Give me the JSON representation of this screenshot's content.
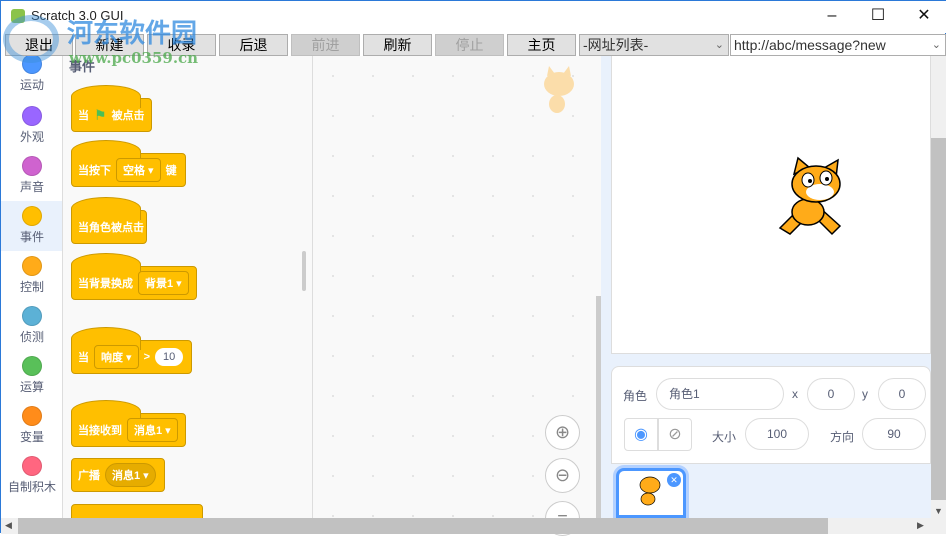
{
  "window": {
    "title": "Scratch 3.0 GUI",
    "controls": [
      "minimize",
      "maximize",
      "close"
    ]
  },
  "toolbar": {
    "buttons": [
      {
        "label": "退出",
        "enabled": true
      },
      {
        "label": "新建",
        "enabled": true
      },
      {
        "label": "收录",
        "enabled": true
      },
      {
        "label": "后退",
        "enabled": true
      },
      {
        "label": "前进",
        "enabled": false
      },
      {
        "label": "刷新",
        "enabled": true
      },
      {
        "label": "停止",
        "enabled": false
      },
      {
        "label": "主页",
        "enabled": true
      }
    ],
    "url_list": "-网址列表-",
    "url": "http://abc/message?new"
  },
  "categories": [
    {
      "label": "运动",
      "color": "#4c97ff"
    },
    {
      "label": "外观",
      "color": "#9966ff"
    },
    {
      "label": "声音",
      "color": "#cf63cf"
    },
    {
      "label": "事件",
      "color": "#ffbf00",
      "selected": true
    },
    {
      "label": "控制",
      "color": "#ffab19"
    },
    {
      "label": "侦测",
      "color": "#5cb1d6"
    },
    {
      "label": "运算",
      "color": "#59c059"
    },
    {
      "label": "变量",
      "color": "#ff8c1a"
    },
    {
      "label": "自制积木",
      "color": "#ff6680"
    }
  ],
  "palette": {
    "heading": "事件",
    "blocks": {
      "flag": {
        "pre": "当",
        "post": "被点击"
      },
      "key": {
        "pre": "当按下",
        "dropdown": "空格",
        "post": "键"
      },
      "sprite": {
        "text": "当角色被点击"
      },
      "backdrop": {
        "pre": "当背景换成",
        "dropdown": "背景1"
      },
      "loud": {
        "pre": "当",
        "dropdown": "响度",
        "op": ">",
        "value": "10"
      },
      "receive": {
        "pre": "当接收到",
        "dropdown": "消息1"
      },
      "broadcast": {
        "pre": "广播",
        "dropdown": "消息1"
      }
    }
  },
  "sprite_info": {
    "sprite_label": "角色",
    "sprite_name": "角色1",
    "x_label": "x",
    "x": "0",
    "y_label": "y",
    "y": "0",
    "size_label": "大小",
    "size": "100",
    "direction_label": "方向",
    "direction": "90"
  },
  "watermark": {
    "name": "河东软件园",
    "url": "www.pc0359.cn"
  },
  "colors": {
    "accent": "#4c97ff",
    "events": "#ffbf00"
  }
}
